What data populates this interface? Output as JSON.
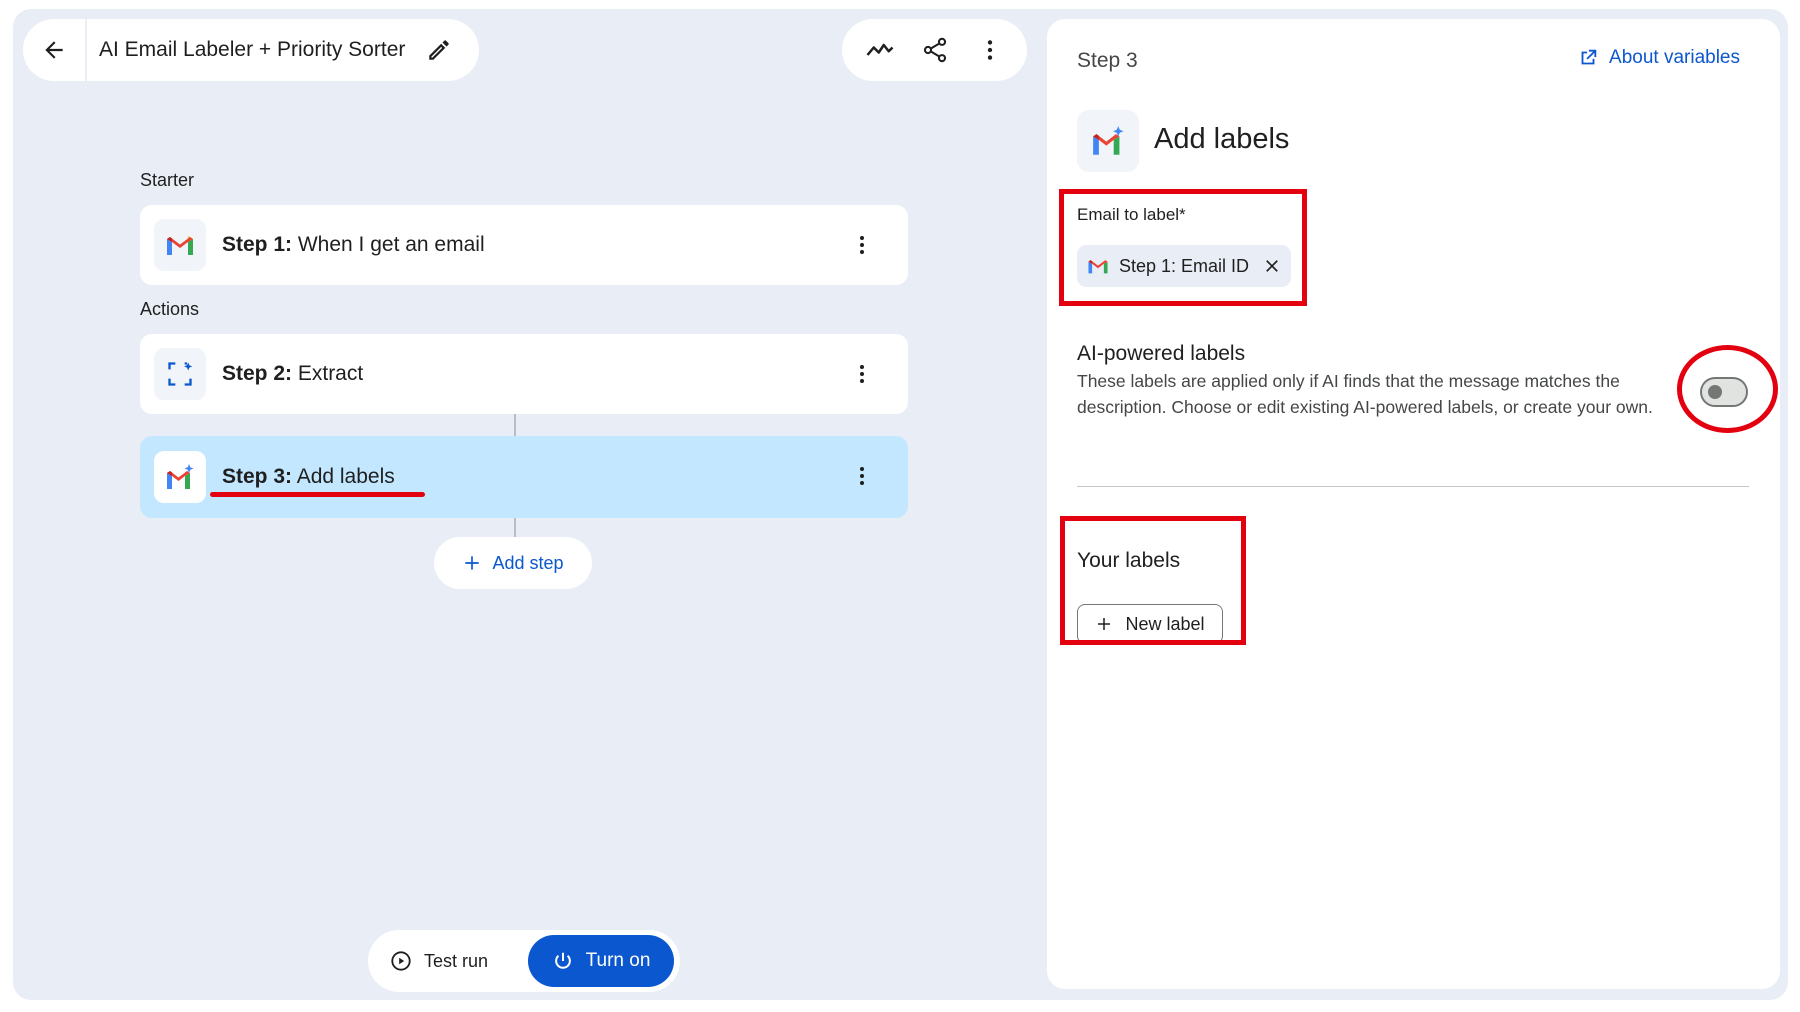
{
  "header": {
    "title": "AI Email Labeler + Priority Sorter",
    "icons": [
      "back-arrow-icon",
      "pencil-icon",
      "activity-icon",
      "share-icon",
      "more-vert-icon"
    ]
  },
  "flow": {
    "starter_label": "Starter",
    "actions_label": "Actions",
    "steps": [
      {
        "prefix": "Step 1:",
        "name": " When I get an email",
        "icon": "gmail-icon",
        "selected": false
      },
      {
        "prefix": "Step 2:",
        "name": " Extract",
        "icon": "extract-icon",
        "selected": false
      },
      {
        "prefix": "Step 3:",
        "name": " Add labels",
        "icon": "gmail-ai-icon",
        "selected": true
      }
    ],
    "add_step_label": "Add step"
  },
  "bottom_bar": {
    "test_run_label": "Test run",
    "turn_on_label": "Turn on"
  },
  "panel": {
    "step_label": "Step 3",
    "about_variables_label": "About variables",
    "heading": "Add labels",
    "email_to_label": {
      "label": "Email to label*",
      "chip_text": "Step 1: Email ID"
    },
    "ai_labels": {
      "title": "AI-powered labels",
      "description": "These labels are applied only if AI finds that the message matches the description. Choose or edit existing AI-powered labels, or create your own.",
      "toggle_on": false
    },
    "your_labels": {
      "title": "Your labels",
      "new_label_button": "New label"
    }
  },
  "colors": {
    "canvas_bg": "#e9eef6",
    "selected_step": "#c2e7ff",
    "primary_blue": "#0b57d0",
    "annotation_red": "#e3000f"
  }
}
